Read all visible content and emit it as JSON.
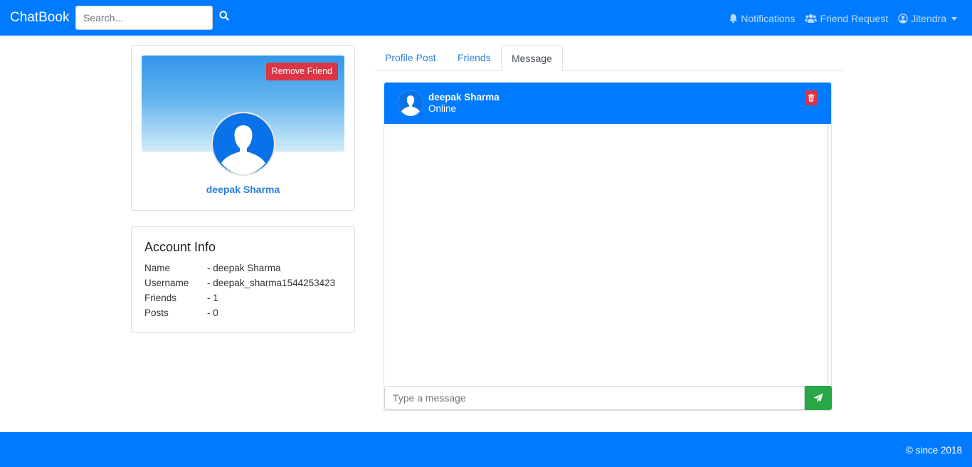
{
  "navbar": {
    "brand": "ChatBook",
    "search_placeholder": "Search...",
    "search_icon": "search-icon",
    "notifications_label": "Notifications",
    "notifications_icon": "bell-icon",
    "friend_request_label": "Friend Request",
    "friend_request_icon": "users-icon",
    "user_label": "Jitendra",
    "user_icon": "user-circle-icon"
  },
  "profile": {
    "remove_friend_label": "Remove Friend",
    "name": "deepak Sharma",
    "avatar_icon": "user-silhouette-icon"
  },
  "account_info": {
    "title": "Account Info",
    "rows": [
      {
        "label": "Name",
        "value": "- deepak Sharma"
      },
      {
        "label": "Username",
        "value": "- deepak_sharma1544253423"
      },
      {
        "label": "Friends",
        "value": "- 1"
      },
      {
        "label": "Posts",
        "value": "- 0"
      }
    ]
  },
  "tabs": [
    {
      "label": "Profile Post",
      "active": false
    },
    {
      "label": "Friends",
      "active": false
    },
    {
      "label": "Message",
      "active": true
    }
  ],
  "chat": {
    "name": "deepak Sharma",
    "status": "Online",
    "delete_icon": "trash-icon",
    "input_placeholder": "Type a message",
    "send_icon": "paper-plane-icon"
  },
  "footer": {
    "text": "© since 2018"
  },
  "colors": {
    "primary": "#007bff",
    "danger": "#dc3545",
    "success": "#28a745",
    "link": "#2a7ee0"
  }
}
